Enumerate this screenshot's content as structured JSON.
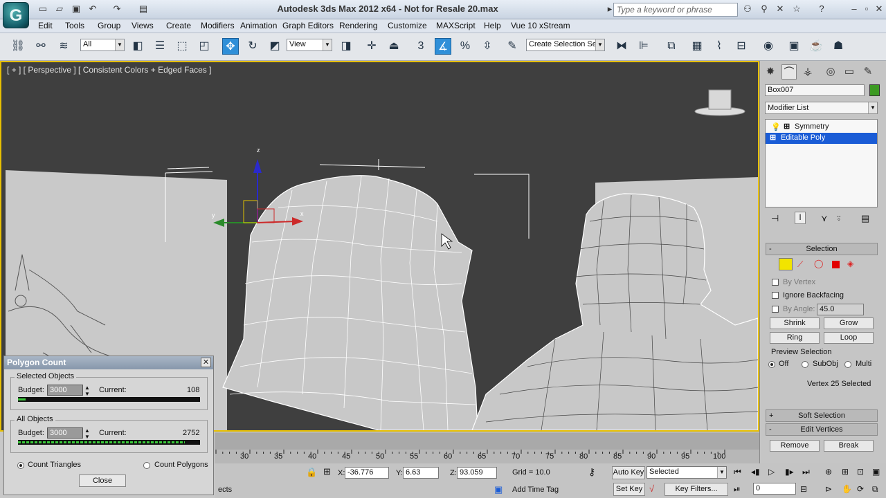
{
  "app": {
    "title": "Autodesk 3ds Max  2012 x64  - Not for Resale   20.max",
    "logo": "G",
    "search_placeholder": "Type a keyword or phrase"
  },
  "menu": [
    "Edit",
    "Tools",
    "Group",
    "Views",
    "Create",
    "Modifiers",
    "Animation",
    "Graph Editors",
    "Rendering",
    "Customize",
    "MAXScript",
    "Help",
    "Vue 10 xStream"
  ],
  "toolbar": {
    "filter_value": "All",
    "refcoord_value": "View",
    "selection_set_value": "Create Selection Se",
    "snap_label": "3"
  },
  "viewport": {
    "label": "[ + ] [ Perspective ] [ Consistent Colors + Edged Faces ]",
    "accent": "#e8c000",
    "gizmo_axes": {
      "x": "x",
      "y": "y",
      "z": "z"
    }
  },
  "polygon_count": {
    "title": "Polygon Count",
    "selected_label": "Selected Objects",
    "all_label": "All Objects",
    "budget_label": "Budget:",
    "current_label": "Current:",
    "selected_budget": "3000",
    "selected_current": "108",
    "selected_fill": 0.04,
    "all_budget": "3000",
    "all_current": "2752",
    "all_fill": 0.917,
    "count_triangles": "Count Triangles",
    "count_polygons": "Count Polygons",
    "close": "Close"
  },
  "command_panel": {
    "object_name": "Box007",
    "object_color": "#3c9a22",
    "modifier_list": "Modifier List",
    "stack": [
      "Symmetry",
      "Editable Poly"
    ],
    "selection_title": "Selection",
    "by_vertex": "By Vertex",
    "ignore_backfacing": "Ignore Backfacing",
    "by_angle": "By Angle:",
    "angle_value": "45.0",
    "shrink": "Shrink",
    "grow": "Grow",
    "ring": "Ring",
    "loop": "Loop",
    "preview_title": "Preview Selection",
    "preview_off": "Off",
    "preview_subobj": "SubObj",
    "preview_multi": "Multi",
    "selected_status": "Vertex 25 Selected",
    "soft_selection": "Soft Selection",
    "edit_vertices": "Edit Vertices",
    "remove": "Remove",
    "break": "Break"
  },
  "timeline": {
    "ticks": [
      "30",
      "35",
      "40",
      "45",
      "50",
      "55",
      "60",
      "65",
      "70",
      "75",
      "80",
      "85",
      "90",
      "95",
      "100"
    ]
  },
  "status": {
    "x_label": "X:",
    "x_value": "-36.776",
    "y_label": "Y:",
    "y_value": "6.63",
    "z_label": "Z:",
    "z_value": "93.059",
    "grid": "Grid = 10.0",
    "add_time_tag": "Add Time Tag",
    "auto_key": "Auto Key",
    "set_key": "Set Key",
    "key_mode": "Selected",
    "key_filters": "Key Filters...",
    "frame": "0",
    "prompt_fragment": "ects"
  }
}
